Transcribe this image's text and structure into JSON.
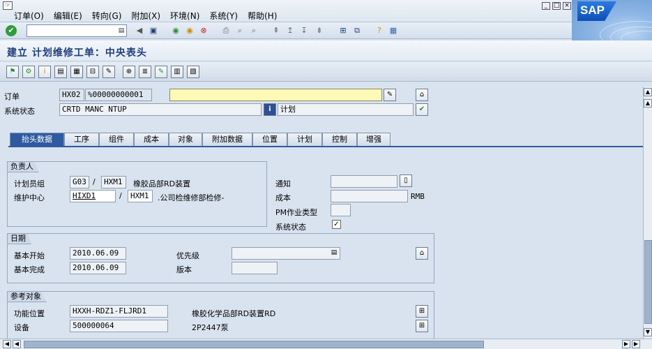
{
  "menu": {
    "items": [
      "订单(O)",
      "编辑(E)",
      "转向(G)",
      "附加(X)",
      "环境(N)",
      "系统(Y)",
      "帮助(H)"
    ]
  },
  "window": {
    "brand": "SAP"
  },
  "toolbar": {
    "command_value": ""
  },
  "title": "建立 计划维修工单：中央表头",
  "header": {
    "order_label": "订单",
    "order_type": "HX02",
    "order_number": "%00000000001",
    "order_text": "",
    "sys_status_label": "系统状态",
    "sys_status_value": "CRTD MANC NTUP",
    "user_status_value": "计划"
  },
  "tabs": [
    "抬头数据",
    "工序",
    "组件",
    "成本",
    "对象",
    "附加数据",
    "位置",
    "计划",
    "控制",
    "增强"
  ],
  "responsible": {
    "title": "负责人",
    "planner_group_label": "计划员组",
    "planner_group_code": "G03",
    "planner_group_plant": "HXM1",
    "planner_group_text": "橡胶品部RD装置",
    "work_center_label": "维护中心",
    "work_center_code": "HIXD1",
    "work_center_plant": "HXM1",
    "work_center_text": ".公司检维修部检修-"
  },
  "side": {
    "notification_label": "通知",
    "notification_value": "",
    "cost_label": "成本",
    "cost_value": "",
    "currency": "RMB",
    "pm_activity_label": "PM作业类型",
    "pm_activity_value": "",
    "sys_status_label": "系统状态",
    "sys_status_checked": "✓"
  },
  "dates": {
    "title": "日期",
    "basic_start_label": "基本开始",
    "basic_start_value": "2010.06.09",
    "basic_finish_label": "基本完成",
    "basic_finish_value": "2010.06.09",
    "priority_label": "优先级",
    "priority_value": "",
    "revision_label": "版本",
    "revision_value": ""
  },
  "reference": {
    "title": "参考对象",
    "func_loc_label": "功能位置",
    "func_loc_value": "HXXH-RDZ1-FLJRD1",
    "func_loc_text": "橡胶化学品部RD装置RD",
    "equipment_label": "设备",
    "equipment_value": "500000064",
    "equipment_text": "2P2447泵"
  }
}
